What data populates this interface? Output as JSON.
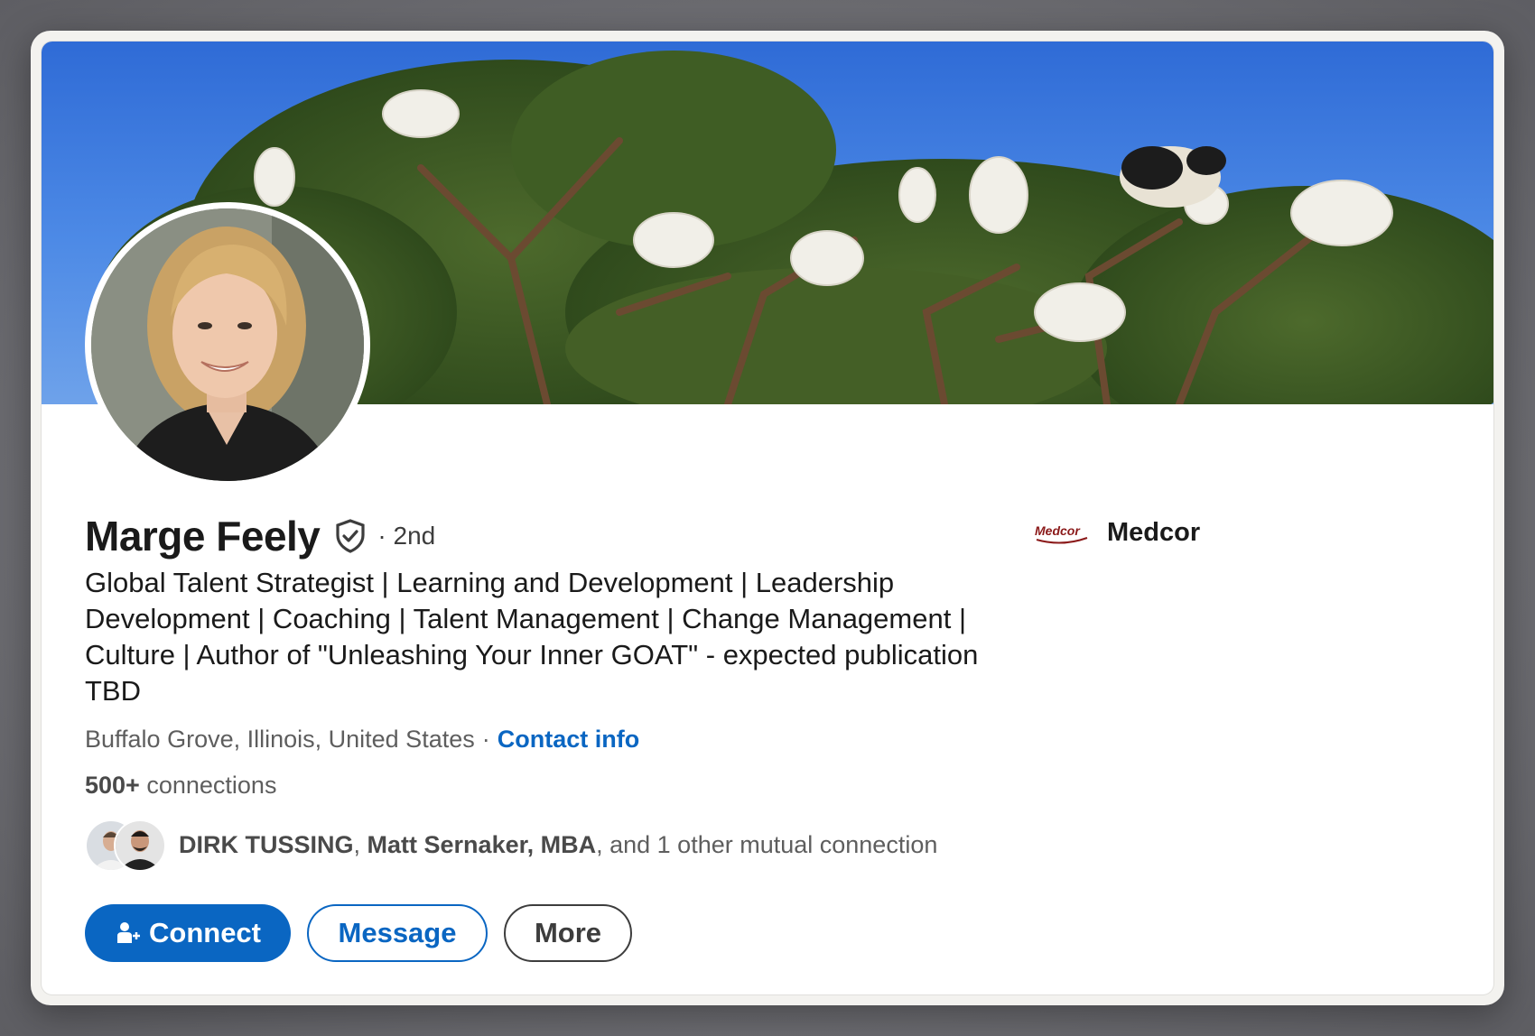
{
  "profile": {
    "name": "Marge Feely",
    "degree": "· 2nd",
    "headline": "Global Talent Strategist | Learning and Development | Leadership Development | Coaching | Talent Management | Change Management | Culture | Author of \"Unleashing Your Inner GOAT\" - expected publication TBD",
    "location": "Buffalo Grove, Illinois, United States",
    "location_separator": "·",
    "contact_info_label": "Contact info",
    "connections_count": "500+",
    "connections_label": "connections",
    "mutual": {
      "first": "DIRK TUSSING",
      "second": "Matt Sernaker, MBA",
      "rest": ", and 1 other mutual connection"
    }
  },
  "company": {
    "name": "Medcor",
    "logo_text": "Medcor",
    "logo_color": "#8b1a1a"
  },
  "actions": {
    "connect_label": "Connect",
    "message_label": "Message",
    "more_label": "More"
  },
  "colors": {
    "accent": "#0a66c2",
    "text_primary": "#1a1a1a",
    "text_secondary": "#5e5e5e"
  },
  "icons": {
    "verified": "verified-shield-icon",
    "connect": "add-person-icon"
  }
}
